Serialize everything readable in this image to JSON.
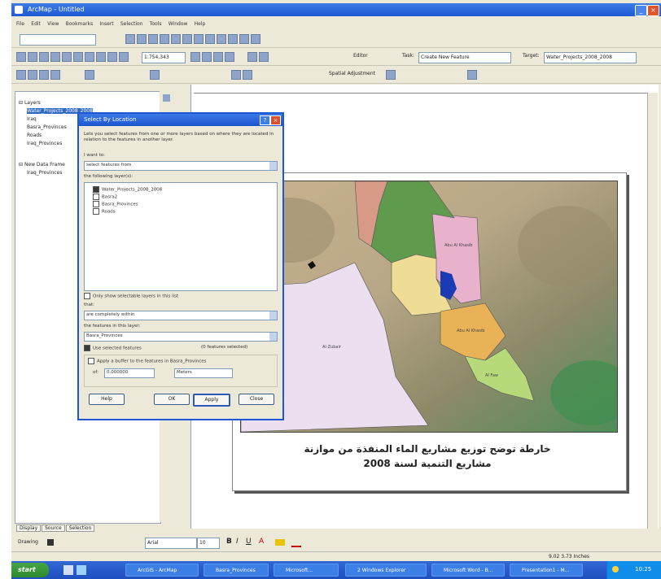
{
  "window": {
    "title": "ArcMap - Untitled",
    "controls": {
      "minimize": "_",
      "maximize": "□",
      "close": "×"
    }
  },
  "menu": [
    "File",
    "Edit",
    "View",
    "Bookmarks",
    "Insert",
    "Selection",
    "Tools",
    "Window",
    "Help"
  ],
  "toolbar": {
    "scale_value": "1:754,343",
    "task_label": "Task:",
    "task_value": "Create New Feature",
    "target_label": "Target:",
    "target_value": "Water_Projects_2008_2008",
    "editor_label": "Editor",
    "spatial_adjustment_label": "Spatial Adjustment"
  },
  "toc": {
    "tabs": [
      "Display",
      "Source",
      "Selection"
    ],
    "layers_group": "Layers",
    "layers": [
      "Water_Projects_2008_2008",
      "Iraq",
      "Basra_Provinces",
      "Roads",
      "Iraq_Provinces"
    ],
    "layout_group": "New Data Frame",
    "layout_layers": [
      "Iraq_Provinces"
    ]
  },
  "dialog": {
    "title": "Select By Location",
    "description": "Lets you select features from one or more layers based on where they are located in relation to the features in another layer.",
    "method_label": "I want to:",
    "method_value": "select features from",
    "layers_label": "the following layer(s):",
    "layer_options": [
      {
        "name": "Water_Projects_2008_2008",
        "checked": true
      },
      {
        "name": "Basra2",
        "checked": false
      },
      {
        "name": "Basra_Provinces",
        "checked": false
      },
      {
        "name": "Roads",
        "checked": false
      }
    ],
    "only_show_label": "Only show selectable layers in this list",
    "that_label": "that:",
    "that_value": "are completely within",
    "features_label": "the features in this layer:",
    "features_value": "Basra_Provinces",
    "use_selected_label": "Use selected features",
    "selected_count": "(0 features selected)",
    "buffer_label": "Apply a buffer to the features in Basra_Provinces",
    "buffer_of_label": "of:",
    "buffer_value": "0.000000",
    "buffer_units": "Meters",
    "buttons": {
      "help": "Help",
      "ok": "OK",
      "apply": "Apply",
      "close": "Close"
    }
  },
  "map": {
    "title_line1": "خارطة توضح توزيع مشاريع الماء المنفذة من موازنة",
    "title_line2": "مشاريع التنمية لسنة",
    "title_year": "2008",
    "region_labels": [
      "Abu Al Khasib",
      "Al-Zubair",
      "Abu Al Khasib",
      "Al Faw"
    ],
    "colors": {
      "pink": "#e8b2cc",
      "green": "#5f9a4d",
      "yellow": "#f0dd95",
      "orange": "#e9b257",
      "lightgreen": "#b7d97a",
      "lavender": "#ecdff0",
      "blue": "#1b3bb5"
    }
  },
  "drawing_toolbar": {
    "drawing_label": "Drawing",
    "font_value": "Arial",
    "size_value": "10"
  },
  "statusbar": {
    "coords": "9.02 3.73 Inches"
  },
  "taskbar": {
    "start": "start",
    "tasks": [
      "ArcGIS - ArcMap",
      "Basra_Provinces",
      "Microsoft...",
      "2 Windows Explorer",
      "Microsoft Word - B...",
      "Presentation1 - M..."
    ],
    "time": "10:25"
  }
}
